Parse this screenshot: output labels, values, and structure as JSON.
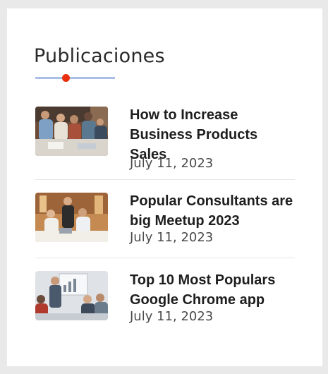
{
  "widget": {
    "title": "Publicaciones",
    "accent_color": "#e8300f",
    "underline_color": "#aabfe6"
  },
  "posts": [
    {
      "title": "How to Increase Business Products Sales",
      "date": "July 11, 2023",
      "thumbnail": "team-meeting-photo"
    },
    {
      "title": "Popular Consultants are big Meetup 2023",
      "date": "July 11, 2023",
      "thumbnail": "office-consultants-photo"
    },
    {
      "title": "Top 10 Most Populars Google Chrome app",
      "date": "July 11, 2023",
      "thumbnail": "presentation-whiteboard-photo"
    }
  ]
}
